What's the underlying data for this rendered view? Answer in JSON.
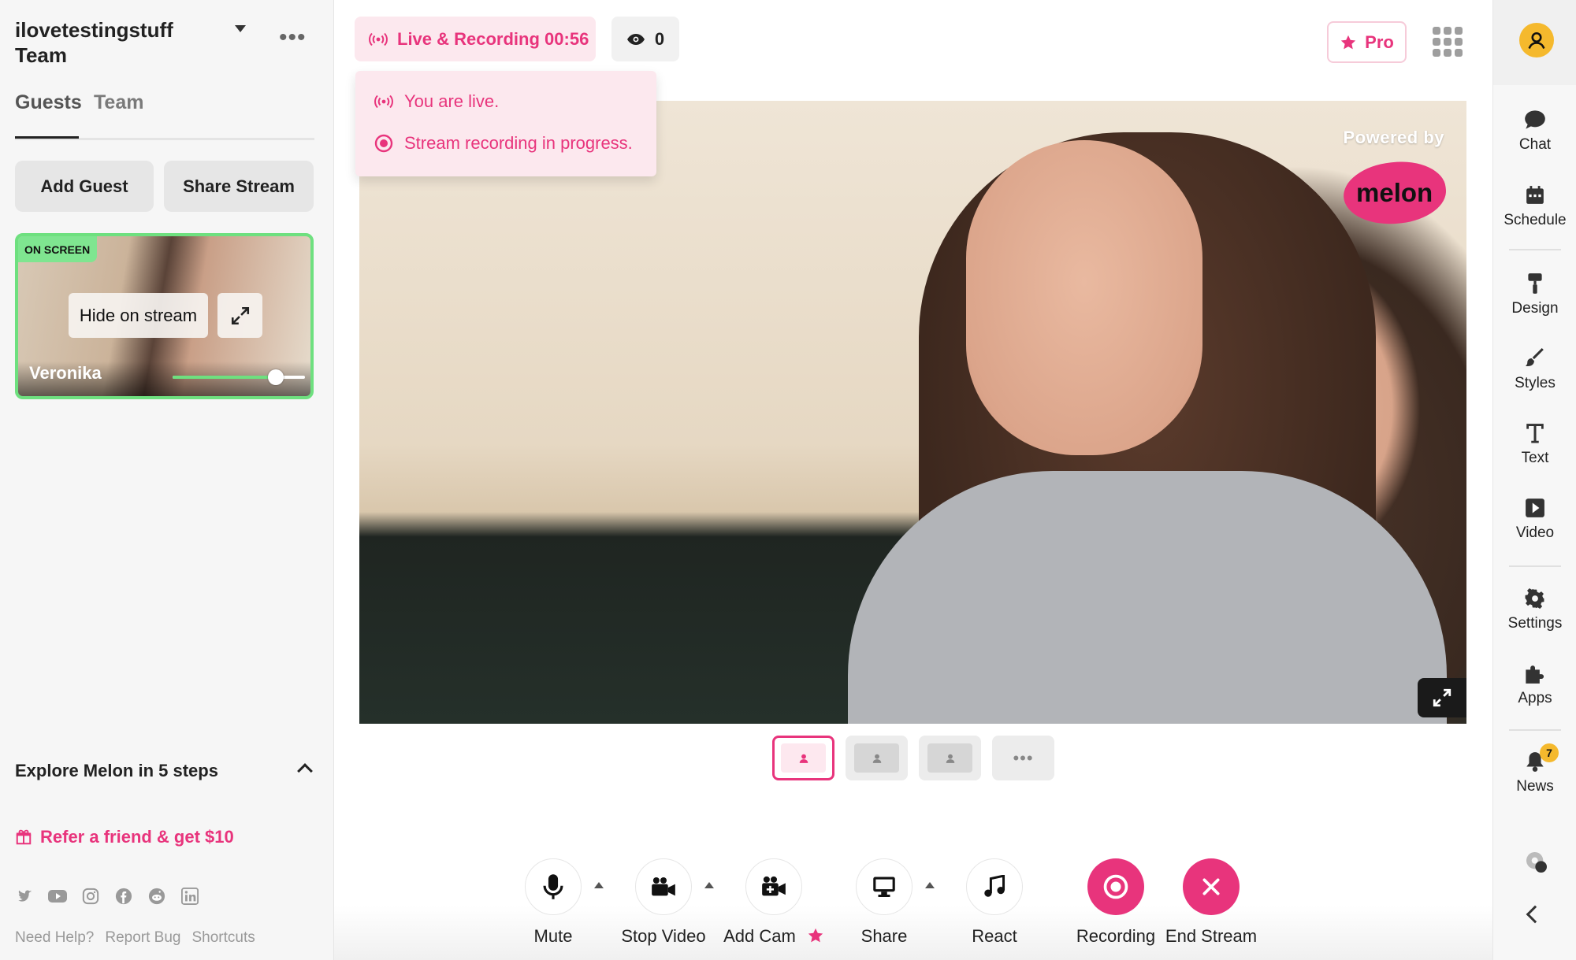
{
  "sidebar": {
    "team_name": "ilovetestingstuff Team",
    "tabs": [
      {
        "label": "Guests"
      },
      {
        "label": "Team"
      }
    ],
    "add_guest_label": "Add Guest",
    "share_stream_label": "Share Stream",
    "guest": {
      "badge": "ON SCREEN",
      "hide_label": "Hide on stream",
      "name": "Veronika",
      "volume": 0.78
    },
    "explore_label": "Explore Melon in 5 steps",
    "refer_label": "Refer a friend & get $10",
    "socials": [
      "twitter-icon",
      "youtube-icon",
      "instagram-icon",
      "facebook-icon",
      "reddit-icon",
      "linkedin-icon"
    ],
    "footer_links": [
      "Need Help?",
      "Report Bug",
      "Shortcuts"
    ]
  },
  "topbar": {
    "live_status": "Live & Recording 00:56",
    "viewer_count": "0",
    "pro_label": "Pro"
  },
  "live_dropdown": {
    "live_text": "You are live.",
    "recording_text": "Stream recording in progress."
  },
  "video": {
    "powered_by": "Powered by",
    "brand": "melon"
  },
  "controls": [
    {
      "key": "mute",
      "label": "Mute",
      "icon": "microphone-icon"
    },
    {
      "key": "stop_video",
      "label": "Stop Video",
      "icon": "camera-icon"
    },
    {
      "key": "add_cam",
      "label": "Add Cam",
      "icon": "add-camera-icon"
    },
    {
      "key": "share",
      "label": "Share",
      "icon": "monitor-icon"
    },
    {
      "key": "react",
      "label": "React",
      "icon": "music-note-icon"
    },
    {
      "key": "recording",
      "label": "Recording",
      "icon": "record-icon"
    },
    {
      "key": "end_stream",
      "label": "End Stream",
      "icon": "close-icon"
    }
  ],
  "rail": {
    "items": [
      {
        "label": "Chat"
      },
      {
        "label": "Schedule"
      },
      {
        "label": "Design"
      },
      {
        "label": "Styles"
      },
      {
        "label": "Text"
      },
      {
        "label": "Video"
      },
      {
        "label": "Settings"
      },
      {
        "label": "Apps"
      },
      {
        "label": "News"
      }
    ],
    "news_badge": "7"
  },
  "colors": {
    "accent": "#e8347c",
    "onscreen_green": "#6ee07f",
    "avatar_yellow": "#f5b92d"
  }
}
